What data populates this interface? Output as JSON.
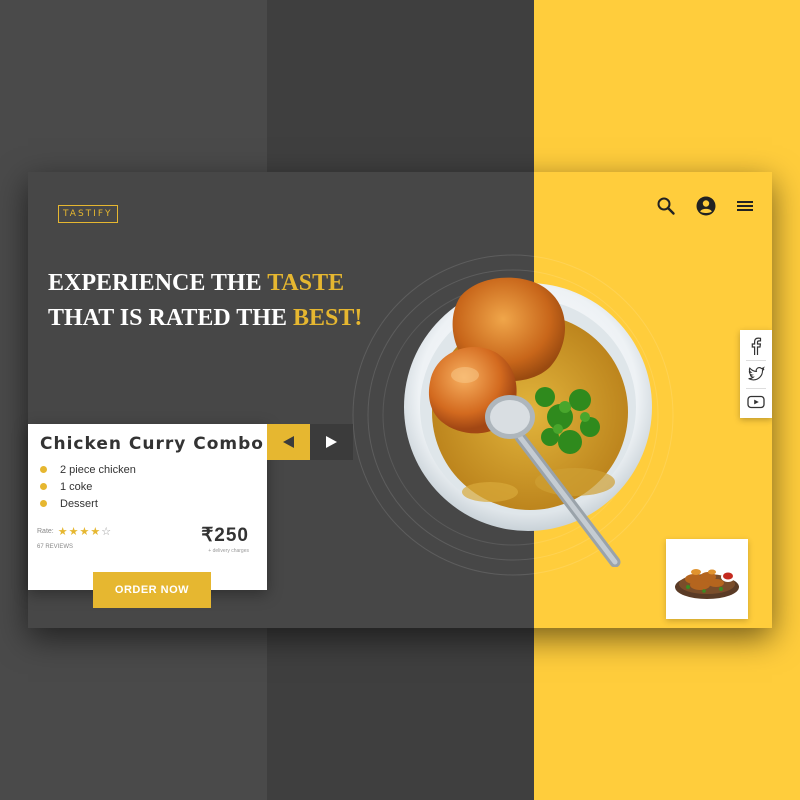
{
  "brand": {
    "logo_text": "TASTIFY"
  },
  "header": {
    "icons": [
      "search-icon",
      "user-icon",
      "menu-icon"
    ]
  },
  "hero": {
    "line1_prefix": "EXPERIENCE THE ",
    "line1_accent": "TASTE",
    "line2_prefix": "THAT IS RATED THE ",
    "line2_accent": "BEST!"
  },
  "product": {
    "name": "Chicken Curry Combo",
    "items": [
      "2 piece chicken",
      "1 coke",
      "Dessert"
    ],
    "rate_label": "Rate:",
    "rating": 4,
    "rating_max": 5,
    "reviews": "67 REVIEWS",
    "price": "₹250",
    "price_note": "+ delivery charges"
  },
  "actions": {
    "order_label": "ORDER NOW"
  },
  "carousel": {
    "prev_icon": "arrow-left-icon",
    "next_icon": "arrow-right-icon"
  },
  "social": {
    "icons": [
      "facebook-icon",
      "twitter-icon",
      "youtube-icon"
    ]
  },
  "colors": {
    "accent": "#e6b730",
    "yellow": "#ffcd3c",
    "dark": "#474747",
    "background": "#4a4a4a"
  }
}
